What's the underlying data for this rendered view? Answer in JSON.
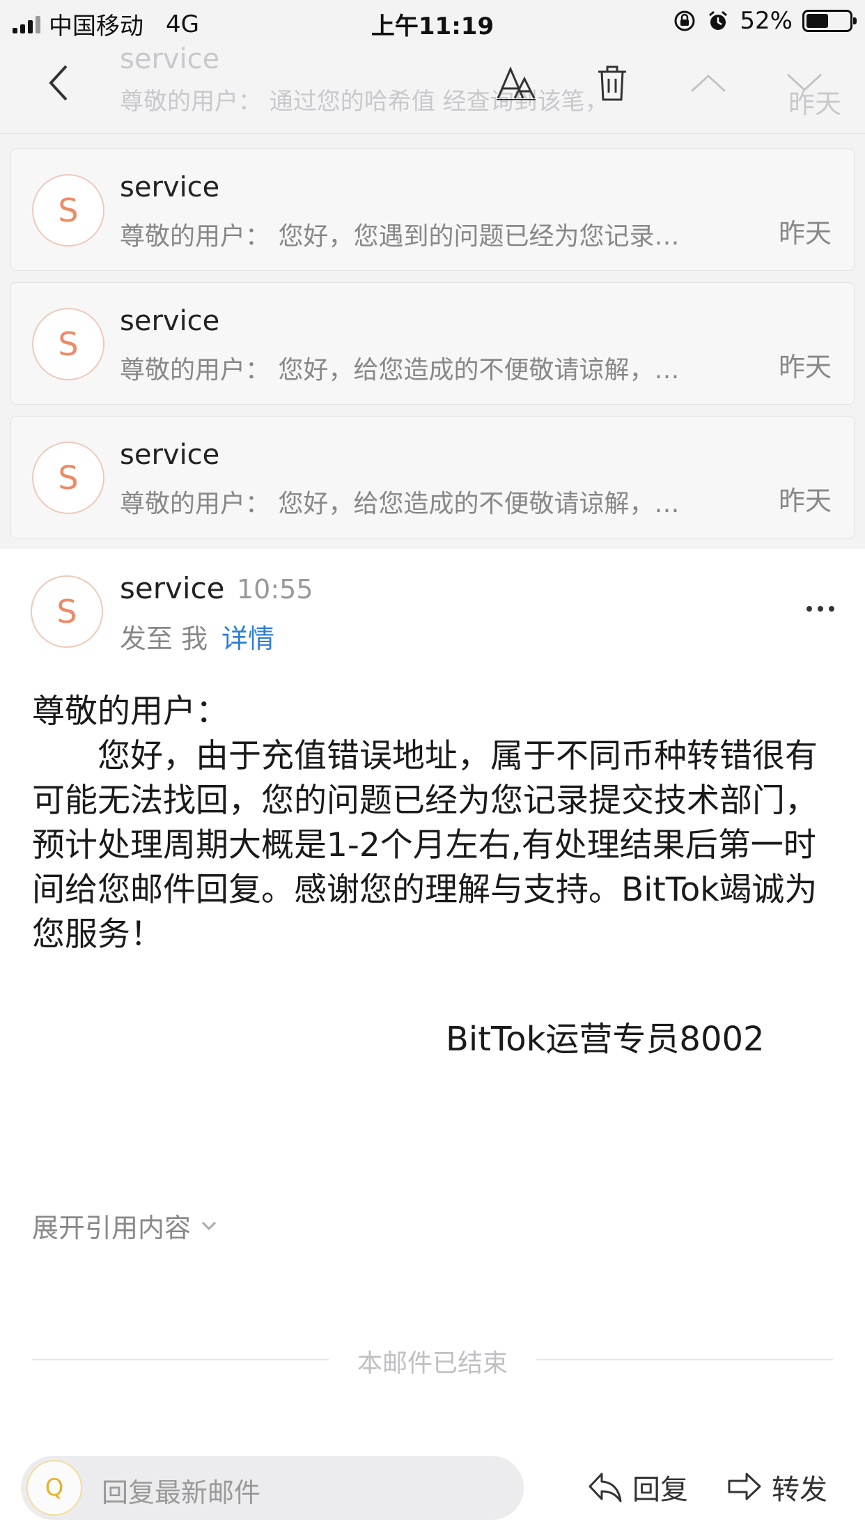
{
  "status_bar": {
    "carrier": "中国移动",
    "network": "4G",
    "time": "上午11:19",
    "battery_percent": "52%",
    "battery_level": 0.52
  },
  "toolbar": {
    "ghost_sender": "service",
    "ghost_preview": "尊敬的用户：  通过您的哈希值  经查询到该笔，",
    "ghost_time": "昨天",
    "icons": [
      "back-icon",
      "font-size-icon",
      "trash-icon",
      "chevron-up-icon",
      "chevron-down-icon"
    ]
  },
  "mail_list": [
    {
      "avatar": "S",
      "sender": "service",
      "preview": "尊敬的用户：  您好，您遇到的问题已经为您记录…",
      "time": "昨天"
    },
    {
      "avatar": "S",
      "sender": "service",
      "preview": "尊敬的用户：  您好，给您造成的不便敬请谅解，…",
      "time": "昨天"
    },
    {
      "avatar": "S",
      "sender": "service",
      "preview": "尊敬的用户：  您好，给您造成的不便敬请谅解，…",
      "time": "昨天"
    }
  ],
  "detail": {
    "avatar": "S",
    "sender": "service",
    "time": "10:55",
    "to_label": "发至 我",
    "details_link": "详情",
    "greeting": "尊敬的用户：",
    "body": "您好，由于充值错误地址，属于不同币种转错很有可能无法找回，您的问题已经为您记录提交技术部门，预计处理周期大概是1-2个月左右,有处理结果后第一时间给您邮件回复。感谢您的理解与支持。BitTok竭诚为您服务！",
    "signature": "BitTok运营专员8002",
    "expand_quote": "展开引用内容",
    "end_notice": "本邮件已结束"
  },
  "bottom_bar": {
    "avatar": "Q",
    "reply_placeholder": "回复最新邮件",
    "reply_label": "回复",
    "forward_label": "转发"
  }
}
